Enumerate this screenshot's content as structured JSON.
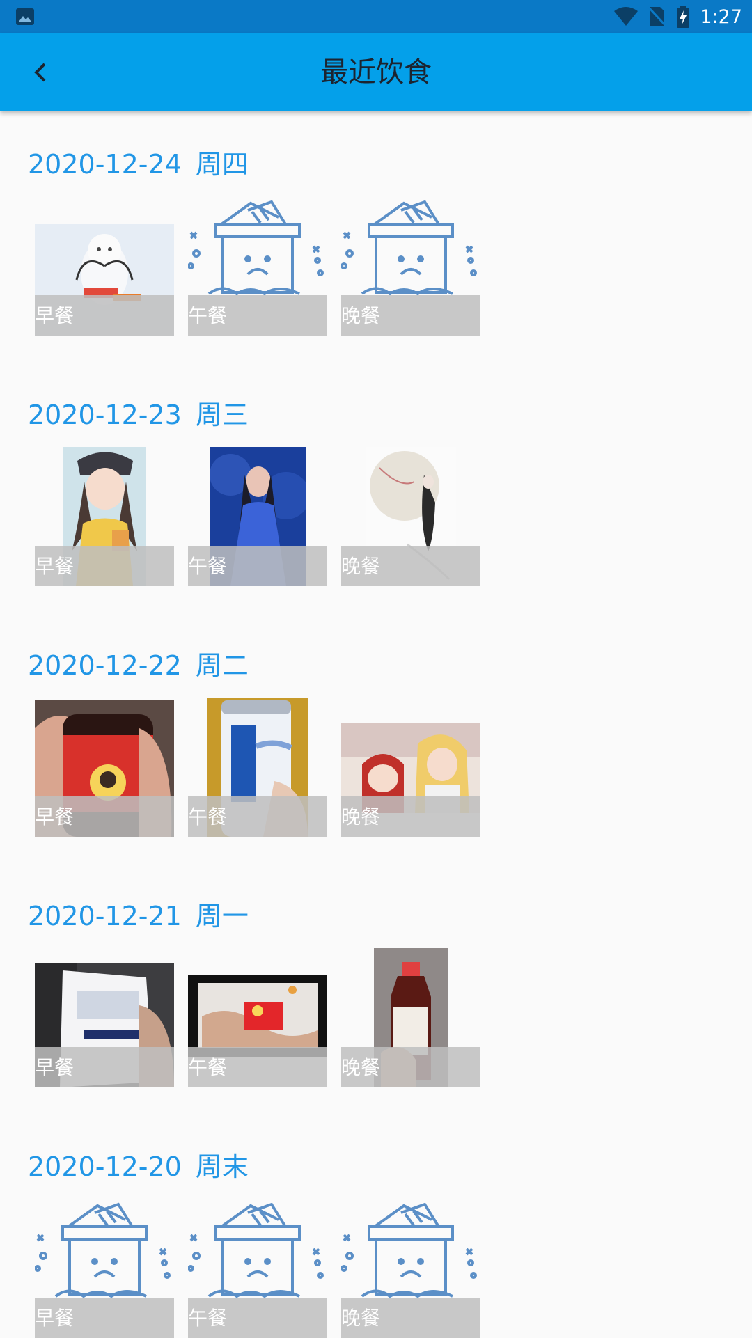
{
  "status_bar": {
    "time": "1:27",
    "icons": [
      "gallery-icon",
      "wifi-icon",
      "no-sim-icon",
      "battery-charging-icon"
    ]
  },
  "app_bar": {
    "title": "最近饮食",
    "back_icon": "chevron-left-icon"
  },
  "colors": {
    "status_bar": "#0a79c6",
    "app_bar": "#04a0ea",
    "date_text": "#2196e6",
    "empty_icon": "#5b8fc7",
    "label_strip": "#bebebe"
  },
  "days": [
    {
      "date": "2020-12-24",
      "weekday": "周四",
      "meals": [
        {
          "label": "早餐",
          "image": "snowy-owl-photo"
        },
        {
          "label": "午餐",
          "image": "empty-box-icon"
        },
        {
          "label": "晚餐",
          "image": "empty-box-icon"
        }
      ]
    },
    {
      "date": "2020-12-23",
      "weekday": "周三",
      "meals": [
        {
          "label": "早餐",
          "image": "anime-girl-cap-image"
        },
        {
          "label": "午餐",
          "image": "blue-dress-girl-image"
        },
        {
          "label": "晚餐",
          "image": "ink-painting-girl-image"
        }
      ]
    },
    {
      "date": "2020-12-22",
      "weekday": "周二",
      "meals": [
        {
          "label": "早餐",
          "image": "hunan-sauce-bottle-photo"
        },
        {
          "label": "午餐",
          "image": "six-walnut-can-photo"
        },
        {
          "label": "晚餐",
          "image": "anime-characters-image"
        }
      ]
    },
    {
      "date": "2020-12-21",
      "weekday": "周一",
      "meals": [
        {
          "label": "早餐",
          "image": "milk-carton-photo"
        },
        {
          "label": "午餐",
          "image": "candy-wrapper-photo"
        },
        {
          "label": "晚餐",
          "image": "tea-bottle-photo"
        }
      ]
    },
    {
      "date": "2020-12-20",
      "weekday": "周末",
      "meals": [
        {
          "label": "早餐",
          "image": "empty-box-icon"
        },
        {
          "label": "午餐",
          "image": "empty-box-icon"
        },
        {
          "label": "晚餐",
          "image": "empty-box-icon"
        }
      ]
    }
  ]
}
